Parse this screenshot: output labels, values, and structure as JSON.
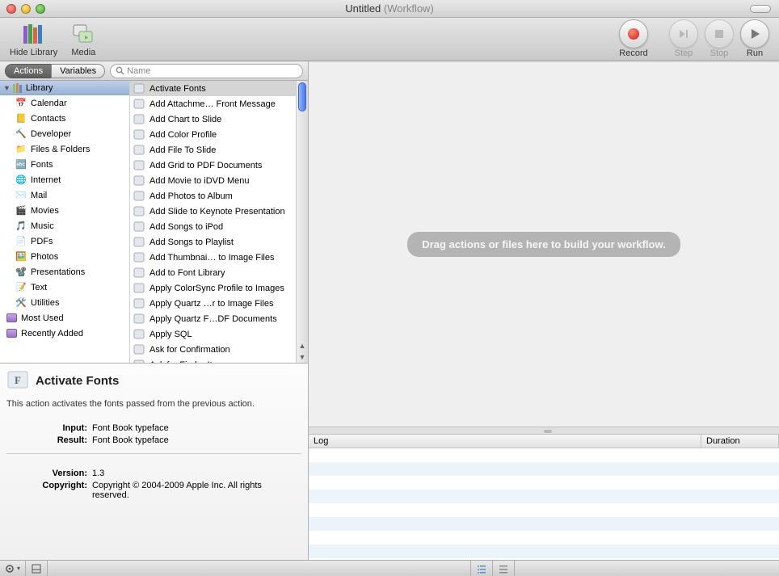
{
  "window": {
    "title": "Untitled",
    "subtitle": "(Workflow)"
  },
  "toolbar": {
    "hide_library": "Hide Library",
    "media": "Media",
    "record": "Record",
    "step": "Step",
    "stop": "Stop",
    "run": "Run"
  },
  "tabs": {
    "actions": "Actions",
    "variables": "Variables"
  },
  "search": {
    "placeholder": "Name"
  },
  "library": {
    "header": "Library",
    "categories": [
      "Calendar",
      "Contacts",
      "Developer",
      "Files & Folders",
      "Fonts",
      "Internet",
      "Mail",
      "Movies",
      "Music",
      "PDFs",
      "Photos",
      "Presentations",
      "Text",
      "Utilities"
    ],
    "smart": [
      "Most Used",
      "Recently Added"
    ]
  },
  "actions": {
    "selected_index": 0,
    "list": [
      "Activate Fonts",
      "Add Attachme… Front Message",
      "Add Chart to Slide",
      "Add Color Profile",
      "Add File To Slide",
      "Add Grid to PDF Documents",
      "Add Movie to iDVD Menu",
      "Add Photos to Album",
      "Add Slide to Keynote Presentation",
      "Add Songs to iPod",
      "Add Songs to Playlist",
      "Add Thumbnai… to Image Files",
      "Add to Font Library",
      "Apply ColorSync Profile to Images",
      "Apply Quartz …r to Image Files",
      "Apply Quartz F…DF Documents",
      "Apply SQL",
      "Ask for Confirmation",
      "Ask for Finder Items"
    ]
  },
  "detail": {
    "title": "Activate Fonts",
    "description": "This action activates the fonts passed from the previous action.",
    "input_label": "Input:",
    "input_value": "Font Book typeface",
    "result_label": "Result:",
    "result_value": "Font Book typeface",
    "version_label": "Version:",
    "version_value": "1.3",
    "copyright_label": "Copyright:",
    "copyright_value": "Copyright © 2004-2009 Apple Inc. All rights reserved."
  },
  "workflow": {
    "placeholder": "Drag actions or files here to build your workflow."
  },
  "log": {
    "col_log": "Log",
    "col_duration": "Duration"
  }
}
